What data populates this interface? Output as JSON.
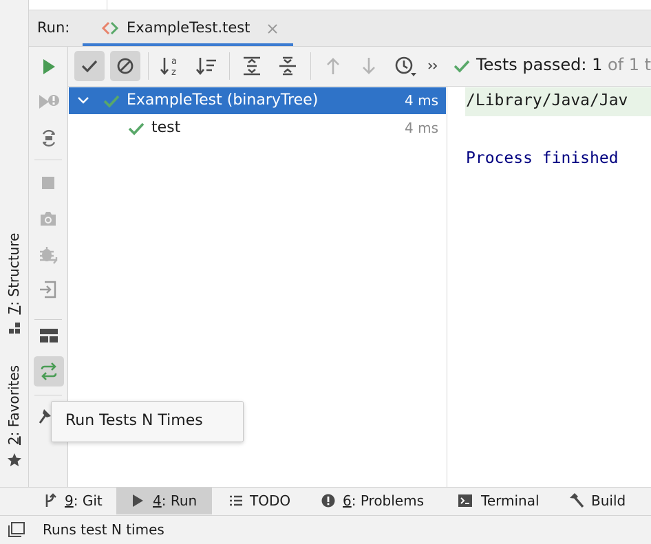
{
  "side_panels": {
    "structure": {
      "number": "7",
      "label": ": Structure"
    },
    "favorites": {
      "number": "2",
      "label": ": Favorites"
    }
  },
  "run_panel": {
    "label": "Run:",
    "tab": {
      "title": "ExampleTest.test"
    }
  },
  "toolbar": {
    "tests_passed_label": "Tests passed: ",
    "tests_passed_count": "1",
    "tests_passed_of": " of 1 t"
  },
  "test_tree": {
    "rows": [
      {
        "name": "ExampleTest (binaryTree)",
        "duration": "4 ms",
        "status": "passed",
        "expanded": true,
        "selected": true
      },
      {
        "name": "test",
        "duration": "4 ms",
        "status": "passed"
      }
    ]
  },
  "console": {
    "lines": [
      "/Library/Java/Jav",
      "Process finished "
    ]
  },
  "tooltip": {
    "text": "Run Tests N Times"
  },
  "bottom_bar": {
    "git": {
      "number": "9",
      "label": ": Git"
    },
    "run": {
      "number": "4",
      "label": ": Run"
    },
    "todo": {
      "label": "TODO"
    },
    "problems": {
      "number": "6",
      "label": ": Problems"
    },
    "terminal": {
      "label": "Terminal"
    },
    "build": {
      "label": "Build"
    }
  },
  "status_bar": {
    "text": "Runs test N times"
  },
  "colors": {
    "accent": "#2f73c8",
    "pass_green": "#59a869",
    "run_green": "#499c54",
    "icon_gray": "#6e6e6e",
    "icon_disabled": "#b4b4b4",
    "console_text": "#000080"
  }
}
